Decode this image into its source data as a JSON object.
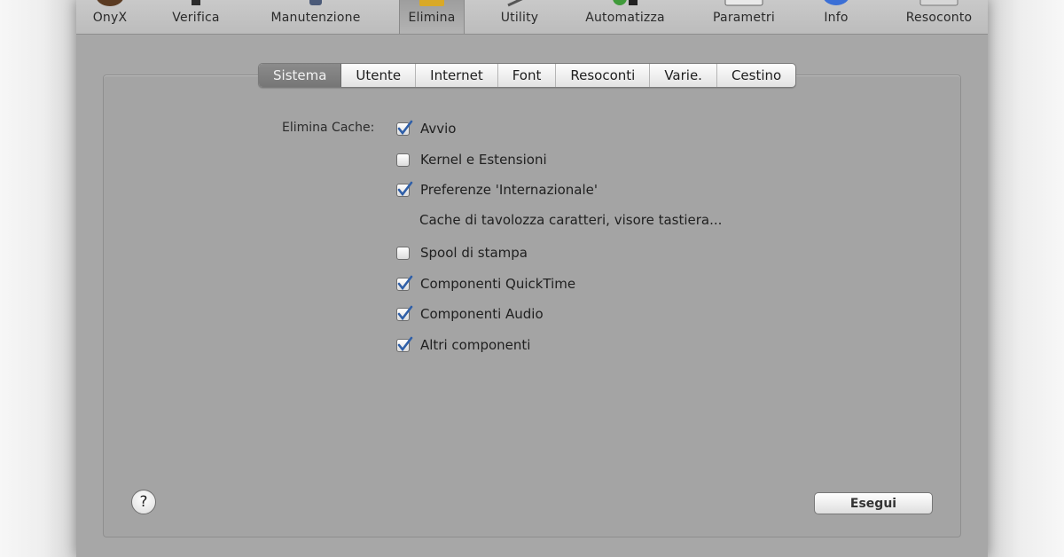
{
  "toolbar": {
    "items": [
      {
        "label": "OnyX",
        "icon": "onyx-icon"
      },
      {
        "label": "Verifica",
        "icon": "verify-icon"
      },
      {
        "label": "Manutenzione",
        "icon": "maintenance-icon"
      },
      {
        "label": "Elimina",
        "icon": "broom-icon",
        "selected": true
      },
      {
        "label": "Utility",
        "icon": "utility-icon"
      },
      {
        "label": "Automatizza",
        "icon": "automate-icon"
      },
      {
        "label": "Parametri",
        "icon": "parameters-icon"
      },
      {
        "label": "Info",
        "icon": "info-icon"
      },
      {
        "label": "Resoconto",
        "icon": "log-icon"
      }
    ]
  },
  "tabs": [
    {
      "label": "Sistema",
      "active": true
    },
    {
      "label": "Utente"
    },
    {
      "label": "Internet"
    },
    {
      "label": "Font"
    },
    {
      "label": "Resoconti"
    },
    {
      "label": "Varie."
    },
    {
      "label": "Cestino"
    }
  ],
  "form": {
    "label": "Elimina Cache:",
    "options": [
      {
        "label": "Avvio",
        "checked": true
      },
      {
        "label": "Kernel e Estensioni",
        "checked": false
      },
      {
        "label": "Preferenze 'Internazionale'",
        "checked": true
      },
      {
        "label": "Spool di stampa",
        "checked": false
      },
      {
        "label": "Componenti QuickTime",
        "checked": true
      },
      {
        "label": "Componenti Audio",
        "checked": true
      },
      {
        "label": "Altri componenti",
        "checked": true
      }
    ],
    "note": "Cache di tavolozza caratteri, visore tastiera..."
  },
  "help": {
    "label": "?"
  },
  "run_button": {
    "label": "Esegui"
  },
  "colors": {
    "check": "#2f5fa8",
    "window_bg": "#a7a7a7",
    "active_tab": "#808080"
  }
}
